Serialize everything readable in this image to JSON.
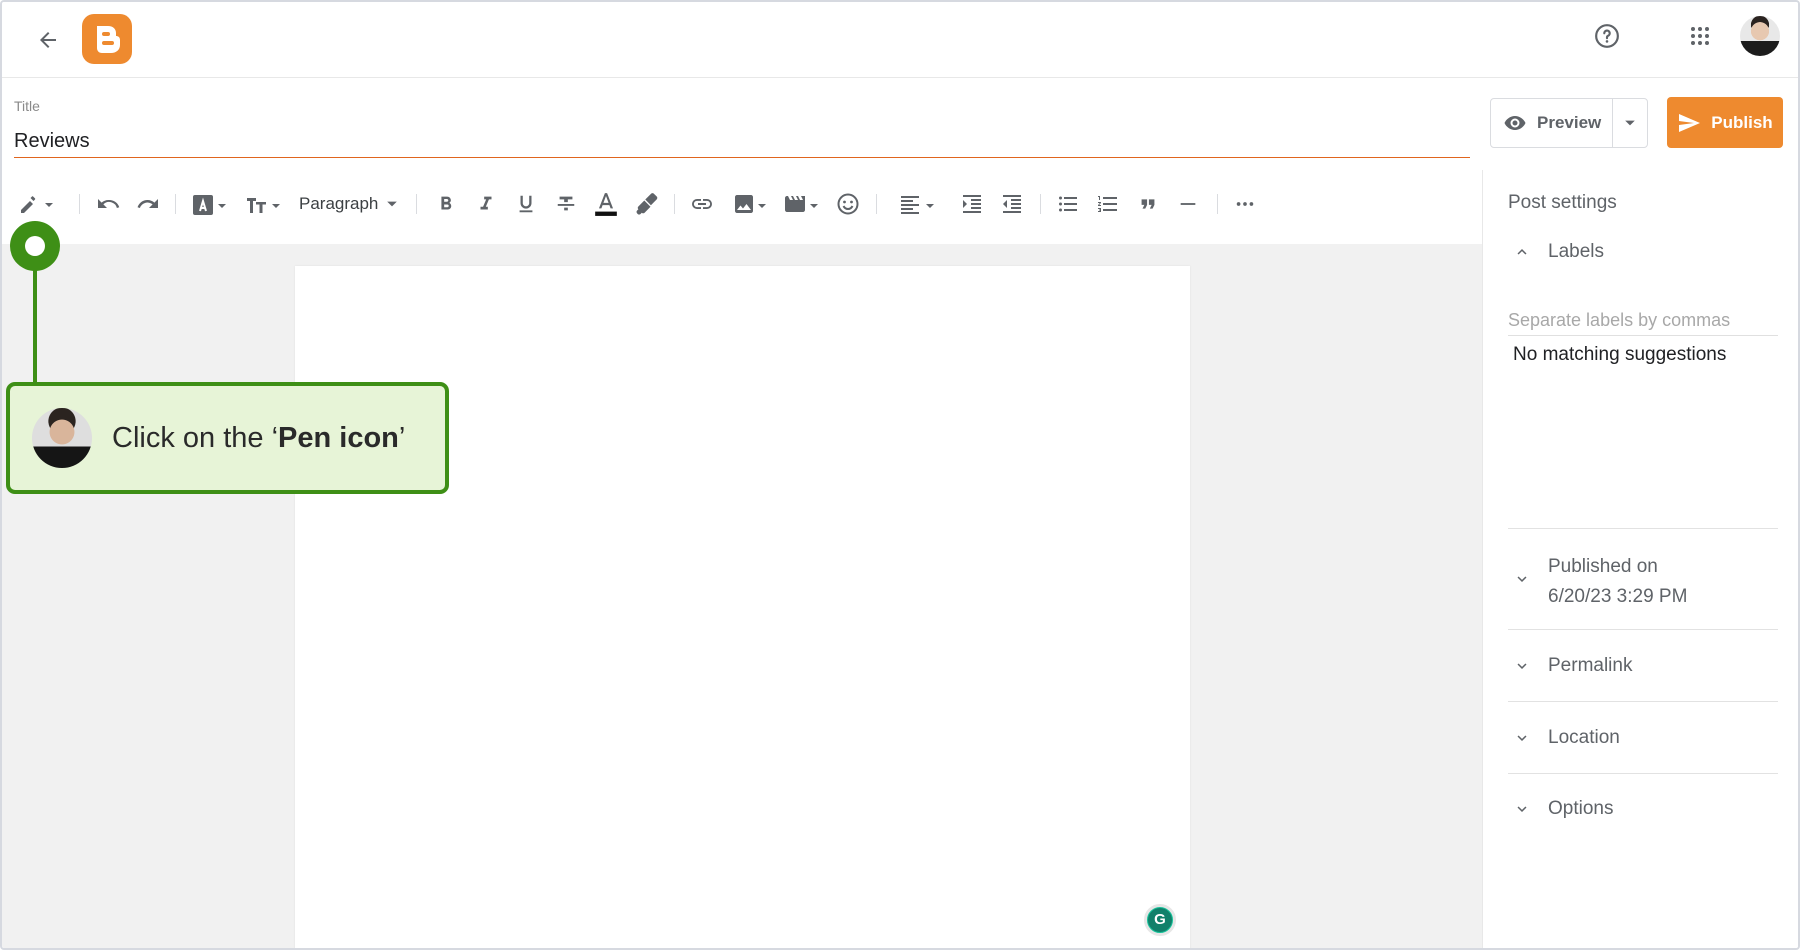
{
  "header": {
    "back_icon": "arrow-left-icon",
    "logo": "blogger-logo",
    "help_icon": "help-circle-icon",
    "apps_icon": "apps-grid-icon",
    "avatar": "user-avatar"
  },
  "title": {
    "label": "Title",
    "value": "Reviews"
  },
  "actions": {
    "preview_label": "Preview",
    "publish_label": "Publish"
  },
  "toolbar": {
    "paragraph_label": "Paragraph",
    "tools": [
      "pen",
      "undo",
      "redo",
      "font",
      "text-size",
      "paragraph",
      "bold",
      "italic",
      "underline",
      "strikethrough",
      "text-color",
      "highlight",
      "link",
      "image",
      "video",
      "emoji",
      "align",
      "indent-more",
      "indent-less",
      "bulleted-list",
      "numbered-list",
      "quote",
      "horizontal-rule",
      "more"
    ]
  },
  "side_panel": {
    "title": "Post settings",
    "labels_heading": "Labels",
    "labels_placeholder": "Separate labels by commas",
    "labels_suggestion": "No matching suggestions",
    "published_line1": "Published on",
    "published_line2": "6/20/23 3:29 PM",
    "permalink": "Permalink",
    "location": "Location",
    "options": "Options"
  },
  "tutorial": {
    "text_prefix": "Click on the ‘",
    "text_bold": "Pen icon",
    "text_suffix": "’"
  },
  "grammarly": {
    "letter": "G"
  },
  "colors": {
    "brand_orange": "#ee8a2f",
    "title_underline": "#e0651e",
    "tutorial_green": "#3e8f16",
    "tutorial_bg": "#e7f4d7"
  }
}
